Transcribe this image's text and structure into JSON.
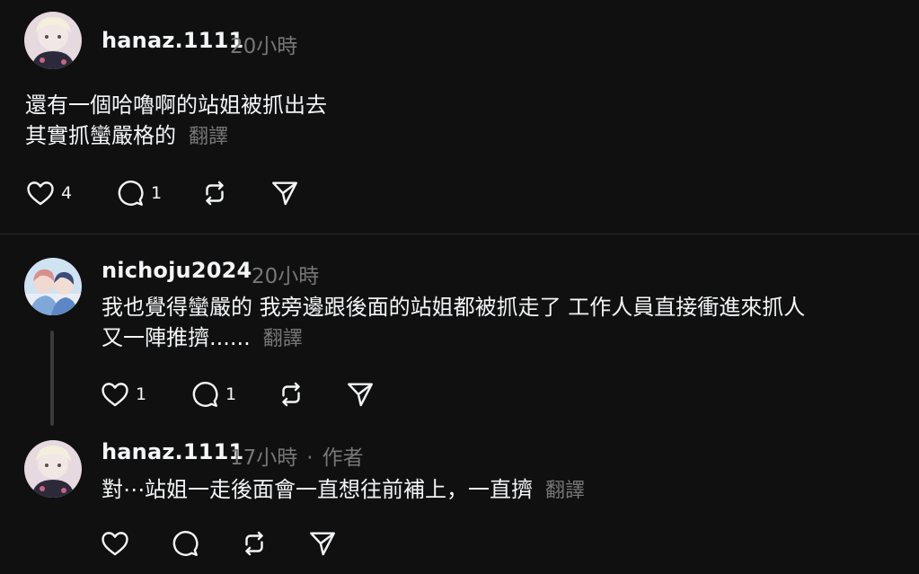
{
  "posts": [
    {
      "username": "hanaz.1111",
      "time": "20小時",
      "lines": [
        "還有一個哈嚕啊的站姐被抓出去",
        "其實抓蠻嚴格的"
      ],
      "translate": "翻譯",
      "likes": "4",
      "comments": "1"
    },
    {
      "username": "nichoju2024",
      "time": "20小時",
      "lines": [
        "我也覺得蠻嚴的 我旁邊跟後面的站姐都被抓走了 工作人員直接衝進來抓人",
        "又一陣推擠......"
      ],
      "translate": "翻譯",
      "likes": "1",
      "comments": "1"
    },
    {
      "username": "hanaz.1111",
      "time": "17小時",
      "separator": "·",
      "author_label": "作者",
      "lines": [
        "對⋯站姐一走後面會一直想往前補上，一直擠"
      ],
      "translate": "翻譯"
    }
  ],
  "icons": {
    "like": "heart-icon",
    "comment": "comment-icon",
    "repost": "repost-icon",
    "share": "share-icon"
  }
}
